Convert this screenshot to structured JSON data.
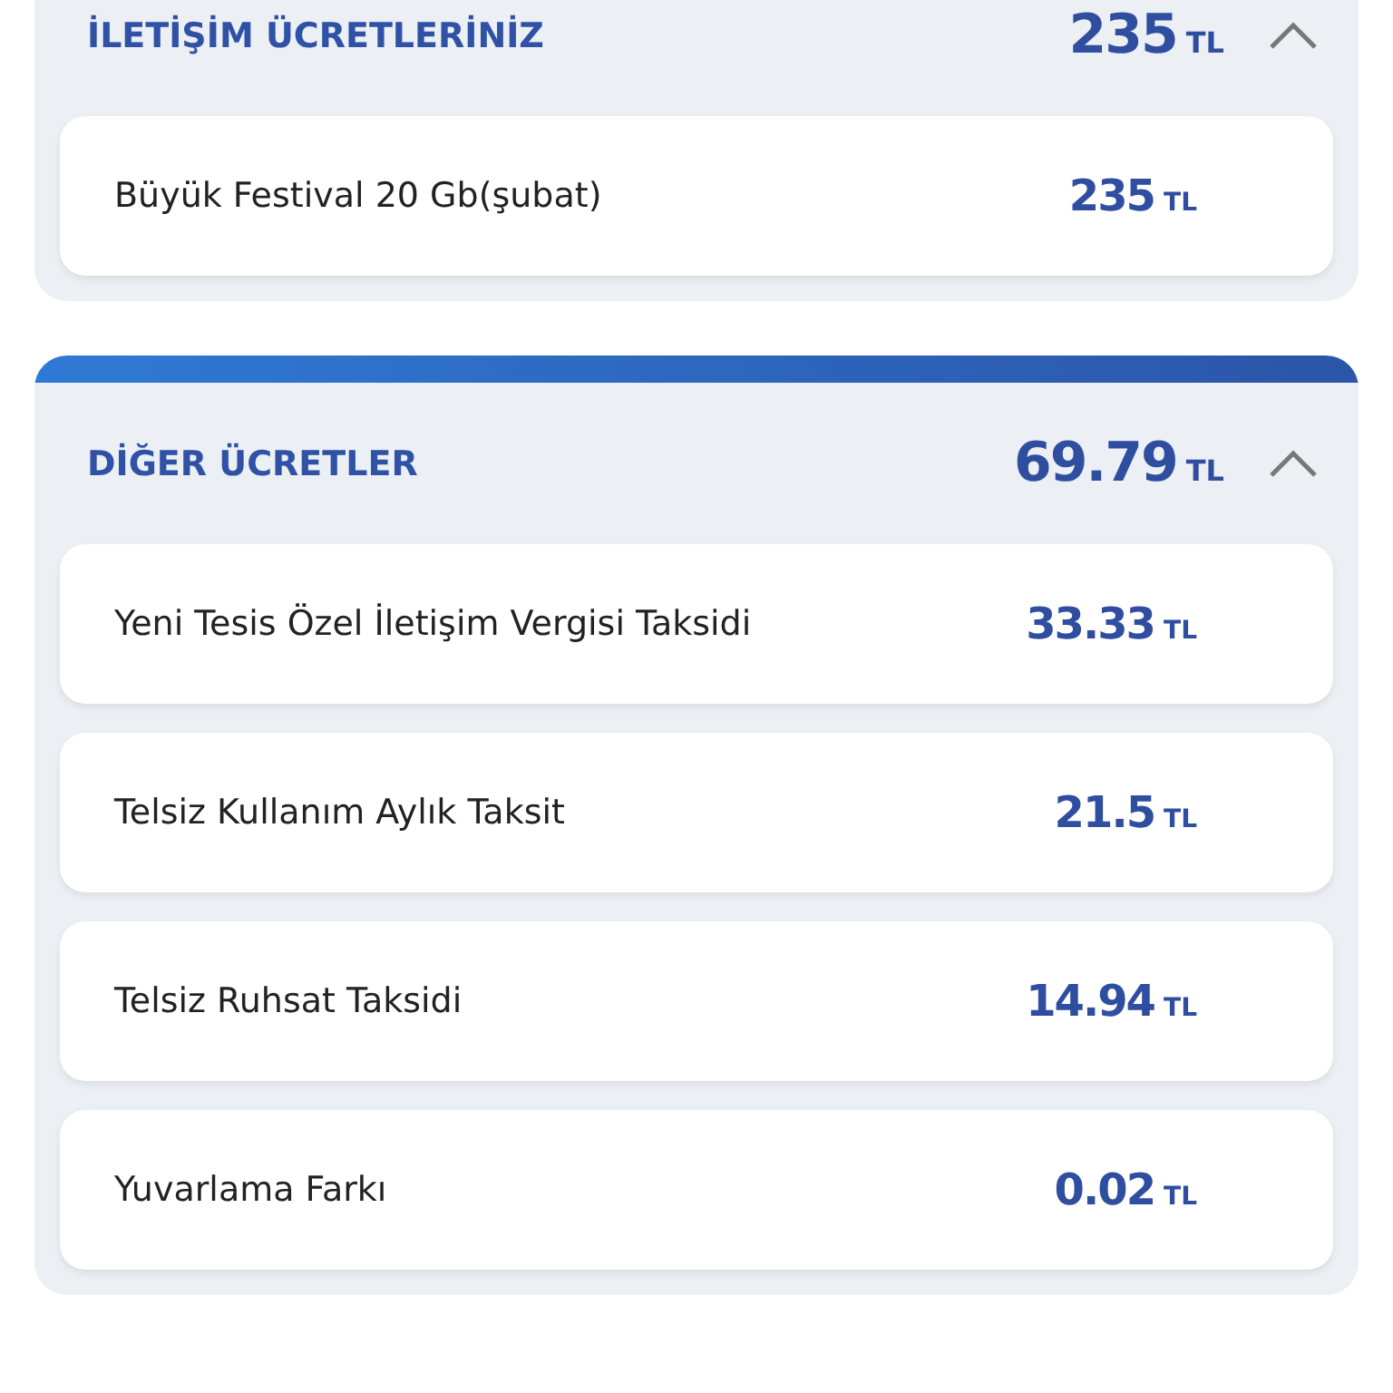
{
  "sections": [
    {
      "title": "İLETİŞİM ÜCRETLERİNİZ",
      "amount": "235",
      "currency": "TL",
      "expanded": true,
      "items": [
        {
          "label": "Büyük Festival 20 Gb(şubat)",
          "amount": "235",
          "currency": "TL"
        }
      ]
    },
    {
      "title": "DİĞER ÜCRETLER",
      "amount": "69.79",
      "currency": "TL",
      "expanded": true,
      "items": [
        {
          "label": "Yeni Tesis Özel İletişim Vergisi Taksidi",
          "amount": "33.33",
          "currency": "TL"
        },
        {
          "label": "Telsiz Kullanım Aylık Taksit",
          "amount": "21.5",
          "currency": "TL"
        },
        {
          "label": "Telsiz Ruhsat Taksidi",
          "amount": "14.94",
          "currency": "TL"
        },
        {
          "label": "Yuvarlama Farkı",
          "amount": "0.02",
          "currency": "TL"
        }
      ]
    }
  ]
}
